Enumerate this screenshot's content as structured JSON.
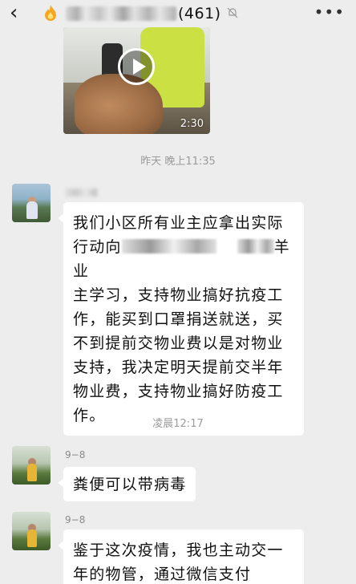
{
  "header": {
    "back_icon": "chevron-left-icon",
    "group_icon": "fire-group-icon",
    "title_count": "(461)",
    "mute_icon": "bell-off-icon",
    "more_label": "•••"
  },
  "video": {
    "duration": "2:30",
    "play_icon": "play-icon"
  },
  "timestamps": {
    "t1": "昨天 晚上11:35",
    "t2": "凌晨12:17"
  },
  "messages": [
    {
      "sender": "",
      "line1": "我们小区所有业主应拿出实际",
      "line2a": "行动向",
      "line2b": "羊业",
      "line3": "主学习，支持物业搞好抗疫工",
      "line4": "作，能买到口罩捐送就送，买",
      "line5": "不到提前交物业费以是对物业",
      "line6": "支持，我决定明天提前交半年",
      "line7": "物业费，支持物业搞好防疫工",
      "line8": "作。"
    },
    {
      "sender": "9−8",
      "text": "粪便可以带病毒"
    },
    {
      "sender": "9−8",
      "line1": "鉴于这次疫情，我也主动交一",
      "line2": "年的物管，通过微信支付"
    }
  ]
}
